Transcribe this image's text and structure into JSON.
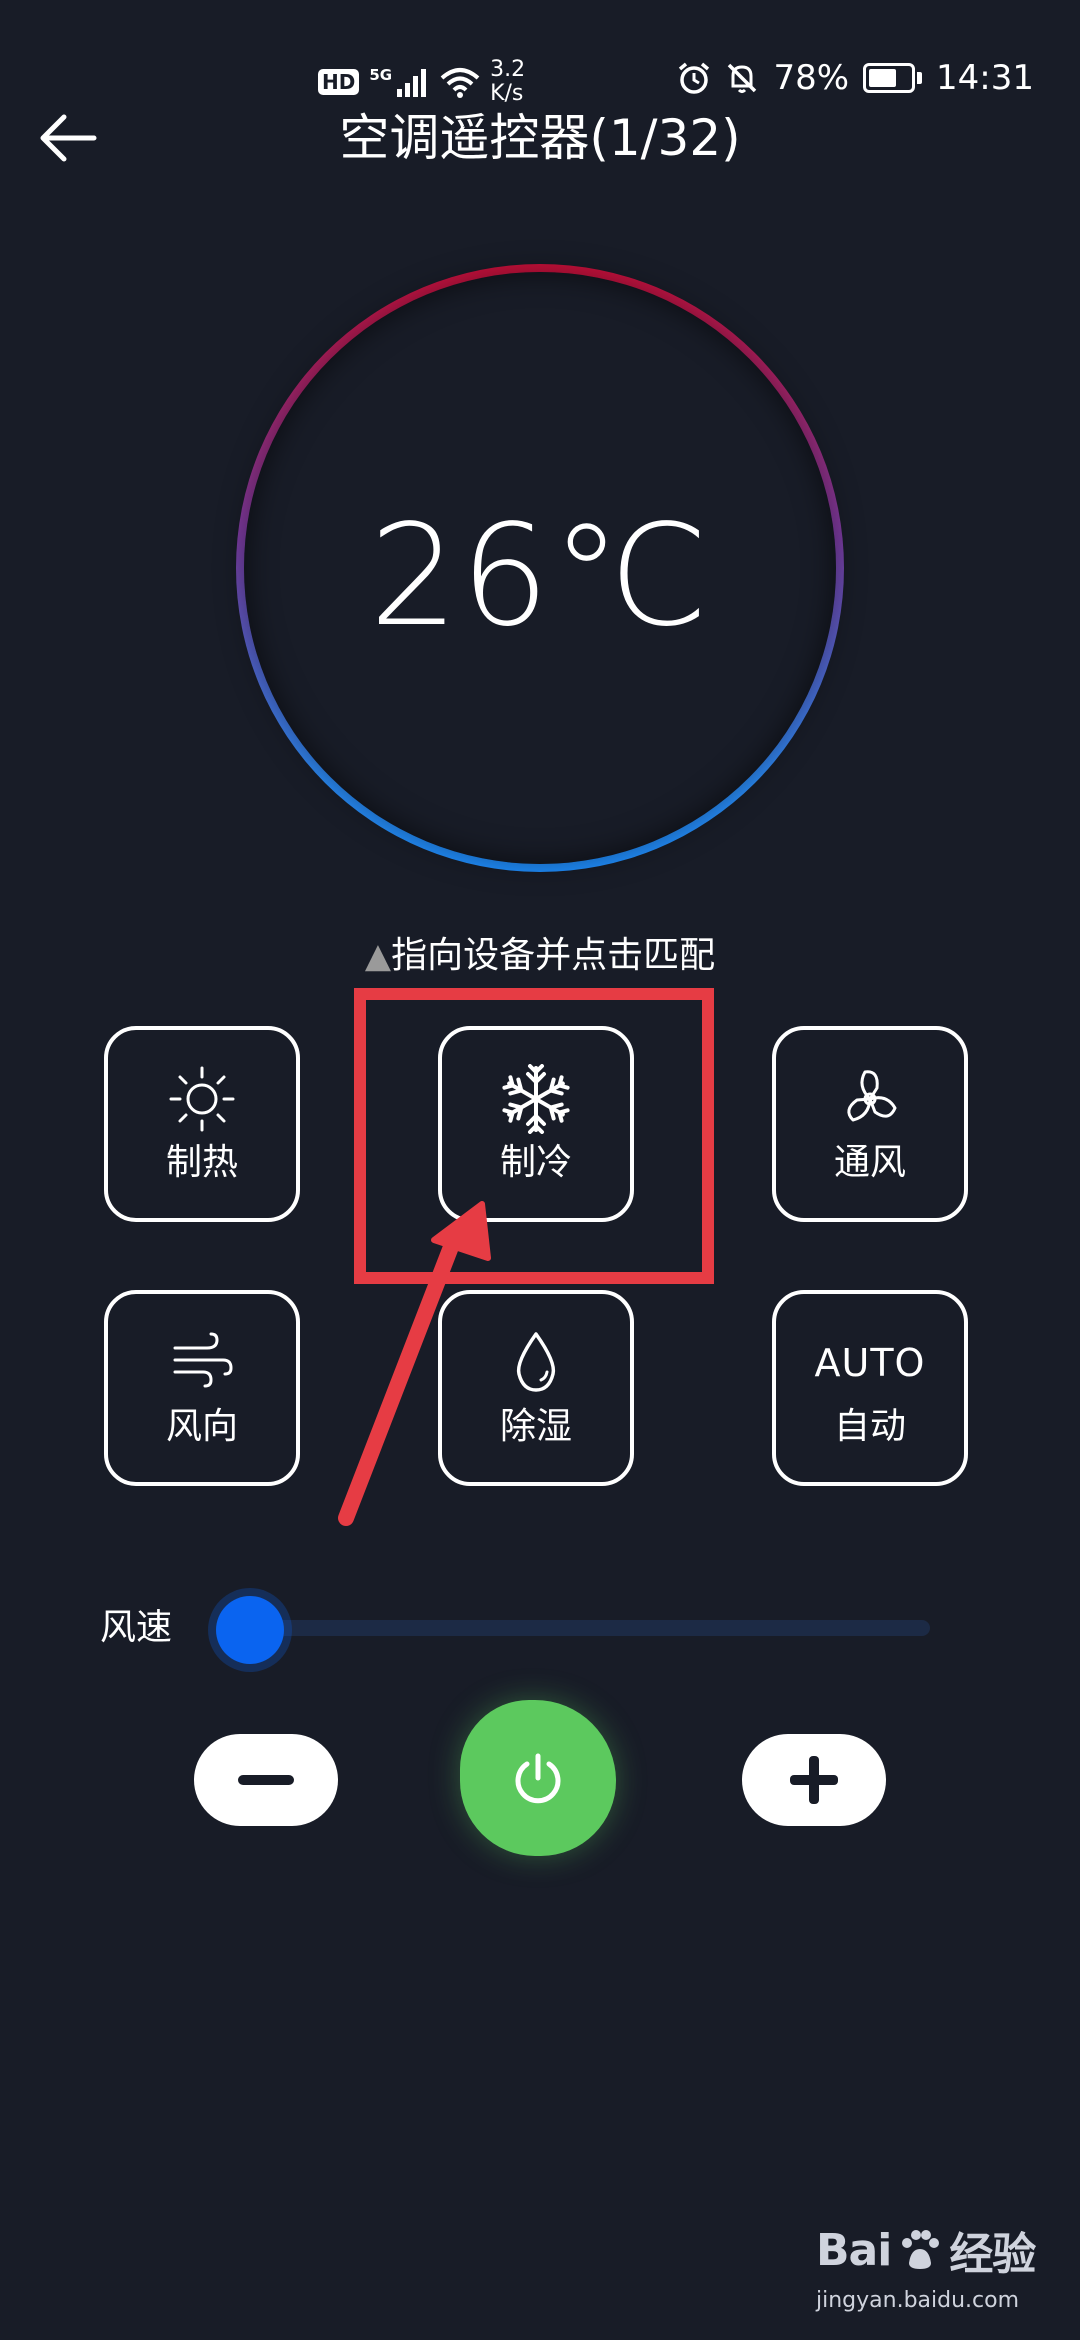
{
  "status_bar": {
    "hd": "HD",
    "net": "5G",
    "speed_value": "3.2",
    "speed_unit": "K/s",
    "battery_percent": "78%",
    "battery_level": 0.78,
    "time": "14:31"
  },
  "header": {
    "title": "空调遥控器(1/32)"
  },
  "dial": {
    "temperature": "26℃"
  },
  "hint": {
    "triangle": "▲",
    "text": "指向设备并点击匹配"
  },
  "modes": [
    {
      "label": "制热",
      "icon": "sun-icon"
    },
    {
      "label": "制冷",
      "icon": "snowflake-icon"
    },
    {
      "label": "通风",
      "icon": "fan-icon"
    },
    {
      "label": "风向",
      "icon": "wind-icon"
    },
    {
      "label": "除湿",
      "icon": "droplet-icon"
    },
    {
      "label": "自动",
      "icon_text": "AUTO"
    }
  ],
  "fan_speed": {
    "label": "风速",
    "level": 0
  },
  "controls": {
    "minus_icon": "minus-icon",
    "power_icon": "power-icon",
    "plus_icon": "plus-icon"
  },
  "colors": {
    "background": "#181c27",
    "accent_blue": "#0a64f0",
    "power_green": "#5cc95e",
    "annotation_red": "#e63c44"
  },
  "watermark": {
    "logo_left": "Bai",
    "logo_right": "经验",
    "url": "jingyan.baidu.com"
  }
}
